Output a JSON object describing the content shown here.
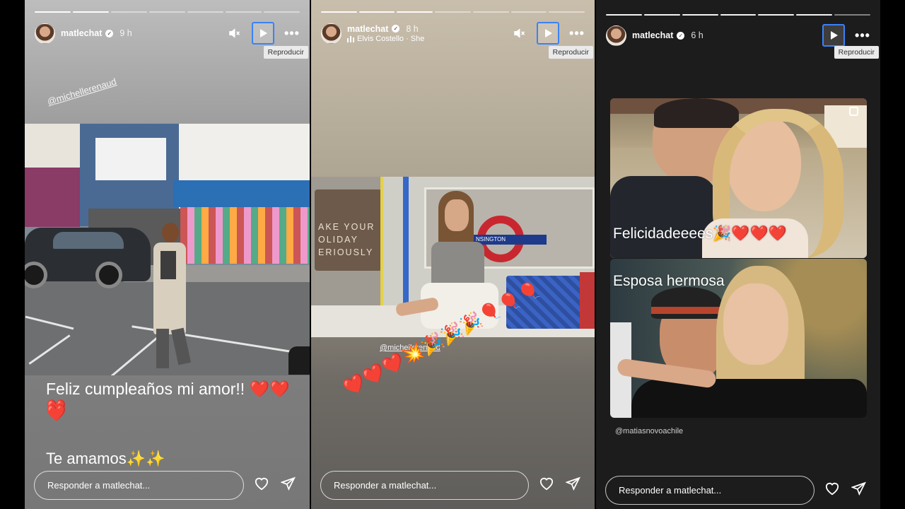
{
  "tooltip_play": "Reproducir",
  "stories": [
    {
      "username": "matlechat",
      "time": "9 h",
      "mention": "@michellerenaud",
      "caption_line1": "Feliz cumpleaños mi amor!! ❤️❤️❤️",
      "caption_line2": "❤️",
      "caption_line3": "Te amamos✨✨",
      "reply_placeholder": "Responder a matlechat..."
    },
    {
      "username": "matlechat",
      "time": "8 h",
      "song": "Elvis Costello · She",
      "mention": "@michellerenaud",
      "poster_text": "AKE YOUR\nOLIDAY\nERIOUSLY",
      "sign_text": "NSINGTON",
      "emoji_line": "❤️❤️❤️💥🎉🎉🎉🎈🎈🎈",
      "reply_placeholder": "Responder a matlechat..."
    },
    {
      "username": "matlechat",
      "time": "6 h",
      "tile1_caption": "Felicidadeeees🎉❤️❤️❤️",
      "tile2_caption": "Esposa hermosa",
      "mention": "@matiasnovoachile",
      "reply_placeholder": "Responder a matlechat..."
    }
  ]
}
